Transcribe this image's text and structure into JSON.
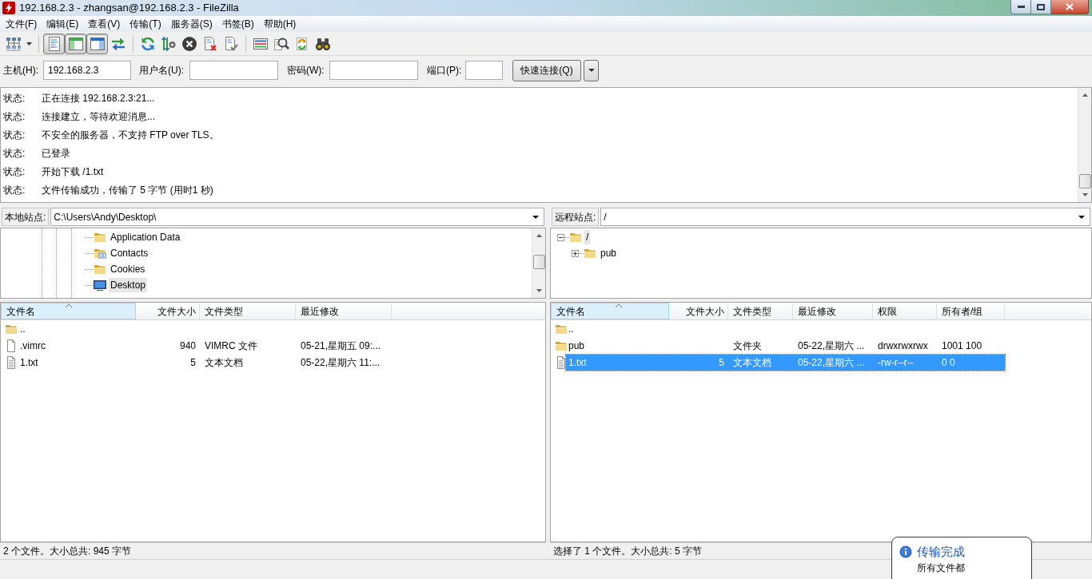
{
  "window": {
    "title": "192.168.2.3 - zhangsan@192.168.2.3 - FileZilla"
  },
  "menu": [
    "文件(F)",
    "编辑(E)",
    "查看(V)",
    "传输(T)",
    "服务器(S)",
    "书签(B)",
    "帮助(H)"
  ],
  "toolbar": [
    [
      {
        "kind": "sitemanager",
        "pressed": false
      },
      {
        "kind": "dropdown",
        "pressed": false
      }
    ],
    [
      {
        "kind": "log",
        "pressed": true
      },
      {
        "kind": "localtree",
        "pressed": true
      },
      {
        "kind": "remotetree",
        "pressed": true
      },
      {
        "kind": "queue",
        "pressed": false
      }
    ],
    [
      {
        "kind": "refresh",
        "pressed": false
      },
      {
        "kind": "process",
        "pressed": false
      },
      {
        "kind": "cancel",
        "pressed": false
      },
      {
        "kind": "disconnect",
        "pressed": false
      },
      {
        "kind": "reconnect",
        "pressed": false
      }
    ],
    [
      {
        "kind": "filter",
        "pressed": false
      },
      {
        "kind": "compare",
        "pressed": false
      },
      {
        "kind": "sync",
        "pressed": false
      },
      {
        "kind": "search",
        "pressed": false
      }
    ]
  ],
  "quickconnect": {
    "fields": [
      {
        "label": "主机(H):",
        "value": "192.168.2.3"
      },
      {
        "label": "用户名(U):"
      },
      {
        "label": "密码(W):"
      },
      {
        "label": "端口(P):"
      }
    ],
    "button": "快速连接(Q)"
  },
  "log": [
    {
      "label": "状态:",
      "message": "正在连接 192.168.2.3:21..."
    },
    {
      "label": "状态:",
      "message": "连接建立，等待欢迎消息..."
    },
    {
      "label": "状态:",
      "message": "不安全的服务器，不支持 FTP over TLS。"
    },
    {
      "label": "状态:",
      "message": "已登录"
    },
    {
      "label": "状态:",
      "message": "开始下载 /1.txt"
    },
    {
      "label": "状态:",
      "message": "文件传输成功，传输了 5 字节 (用时1 秒)"
    }
  ],
  "local": {
    "site_label": "本地站点:",
    "path": "C:\\Users\\Andy\\Desktop\\",
    "tree": [
      {
        "name": "Application Data",
        "kind": "folder",
        "selected": false
      },
      {
        "name": "Contacts",
        "kind": "contacts",
        "selected": false
      },
      {
        "name": "Cookies",
        "kind": "folder",
        "selected": false
      },
      {
        "name": "Desktop",
        "kind": "desktop",
        "selected": true
      }
    ],
    "columns": [
      {
        "label": "文件名",
        "sorted": true
      },
      {
        "label": "文件大小",
        "sorted": false
      },
      {
        "label": "文件类型",
        "sorted": false
      },
      {
        "label": "最近修改",
        "sorted": false
      }
    ],
    "rows": [
      {
        "kind": "folder",
        "name": "..",
        "selected": false
      },
      {
        "kind": "file",
        "name": ".vimrc",
        "size": "940",
        "type": "VIMRC 文件",
        "modified": "05-21,星期五 09:...",
        "selected": false
      },
      {
        "kind": "text",
        "name": "1.txt",
        "size": "5",
        "type": "文本文档",
        "modified": "05-22,星期六 11:...",
        "selected": false
      }
    ],
    "status": "2 个文件。大小总共: 945 字节"
  },
  "remote": {
    "site_label": "远程站点:",
    "path": "/",
    "tree": [
      {
        "name": "/",
        "expanded": true,
        "selected": true,
        "children": [
          {
            "name": "pub",
            "expanded": false,
            "selected": false
          }
        ]
      }
    ],
    "columns": [
      {
        "label": "文件名",
        "sorted": true
      },
      {
        "label": "文件大小",
        "sorted": false
      },
      {
        "label": "文件类型",
        "sorted": false
      },
      {
        "label": "最近修改",
        "sorted": false
      },
      {
        "label": "权限",
        "sorted": false
      },
      {
        "label": "所有者/组",
        "sorted": false
      }
    ],
    "rows": [
      {
        "kind": "folder",
        "name": "..",
        "selected": false
      },
      {
        "kind": "folder",
        "name": "pub",
        "type": "文件夹",
        "modified": "05-22,星期六 ...",
        "permissions": "drwxrwxrwx",
        "owner": "1001 100",
        "selected": false
      },
      {
        "kind": "text",
        "name": "1.txt",
        "size": "5",
        "type": "文本文档",
        "modified": "05-22,星期六 ...",
        "permissions": "-rw-r--r--",
        "owner": "0 0",
        "selected": true
      }
    ],
    "status": "选择了 1 个文件。大小总共: 5 字节"
  },
  "notification": {
    "title": "传输完成",
    "message": "所有文件都"
  }
}
